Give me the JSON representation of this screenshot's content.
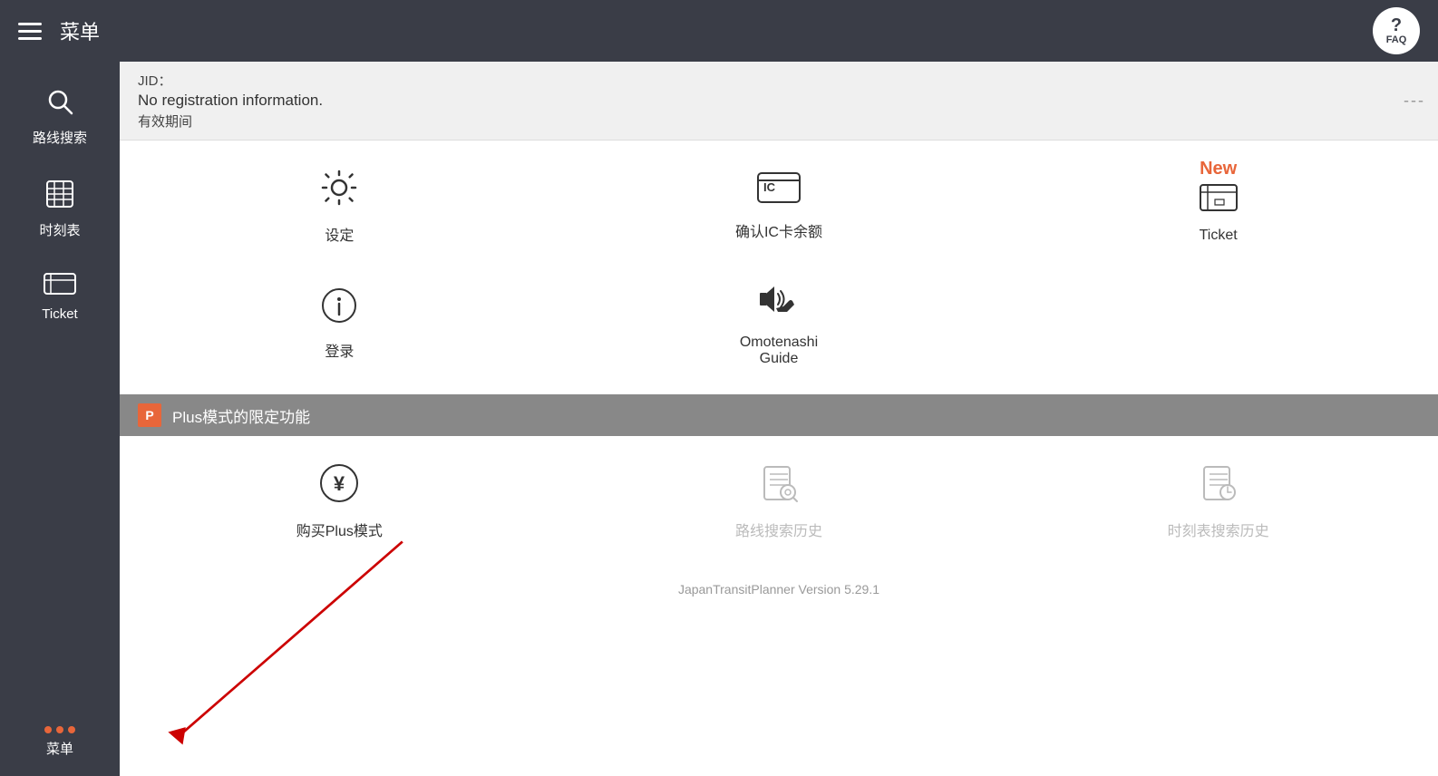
{
  "header": {
    "hamburger_label": "menu",
    "title": "菜单",
    "faq_q": "?",
    "faq_label": "FAQ"
  },
  "sidebar": {
    "items": [
      {
        "id": "search",
        "label": "路线搜索"
      },
      {
        "id": "timetable",
        "label": "时刻表"
      },
      {
        "id": "ticket",
        "label": "Ticket"
      }
    ],
    "bottom": {
      "dots": 3,
      "label": "菜单"
    }
  },
  "jid_bar": {
    "jid_line": "JID：",
    "no_reg": "No registration information.",
    "validity": "有效期间",
    "dots": "---"
  },
  "menu_items": [
    {
      "id": "settings",
      "icon_type": "settings",
      "label": "设定",
      "new": false,
      "disabled": false
    },
    {
      "id": "ic",
      "icon_type": "ic",
      "label": "确认IC卡余额",
      "new": false,
      "disabled": false
    },
    {
      "id": "ticket",
      "icon_type": "ticket",
      "label": "Ticket",
      "new": true,
      "new_label": "New",
      "disabled": false
    },
    {
      "id": "login",
      "icon_type": "info",
      "label": "登录",
      "new": false,
      "disabled": false
    },
    {
      "id": "omotenashi",
      "icon_type": "omotenashi",
      "label": "Omotenashi\nGuide",
      "new": false,
      "disabled": false
    },
    {
      "id": "empty",
      "icon_type": "",
      "label": "",
      "new": false,
      "disabled": false
    }
  ],
  "plus_section": {
    "badge": "P",
    "title": "Plus模式的限定功能"
  },
  "plus_items": [
    {
      "id": "buy-plus",
      "icon_type": "yen",
      "label": "购买Plus模式",
      "disabled": false
    },
    {
      "id": "route-history",
      "icon_type": "search-history",
      "label": "路线搜索历史",
      "disabled": true
    },
    {
      "id": "time-history",
      "icon_type": "time-history",
      "label": "时刻表搜索历史",
      "disabled": true
    }
  ],
  "version": "JapanTransitPlanner Version 5.29.1"
}
